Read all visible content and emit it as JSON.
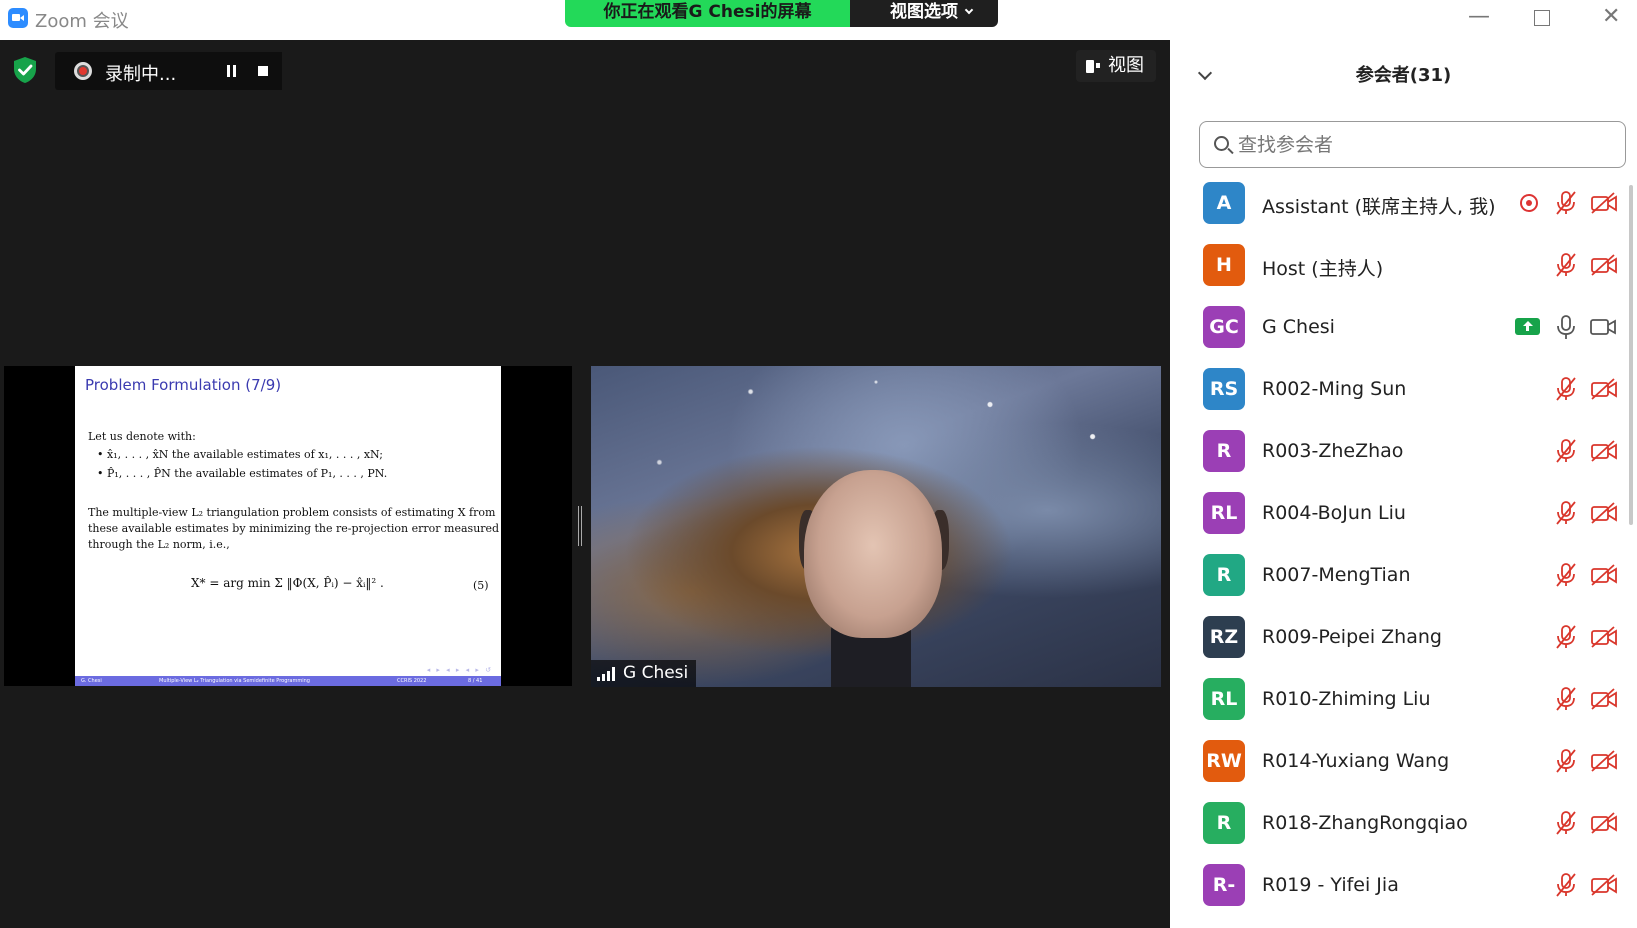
{
  "window": {
    "title": "Zoom 会议",
    "viewing_banner": "你正在观看G  Chesi的屏幕",
    "view_options": "视图选项"
  },
  "toolbar": {
    "recording_label": "录制中...",
    "view_label": "视图"
  },
  "slide": {
    "title": "Problem Formulation (7/9)",
    "intro": "Let us denote with:",
    "bullet_1": "• x̂₁, . . . , x̂N the available estimates of x₁, . . . , xN;",
    "bullet_2": "• P̂₁, . . . , P̂N the available estimates of P₁, . . . , PN.",
    "para_1": "The multiple-view L₂ triangulation problem consists of estimating X from",
    "para_2": "these available estimates by minimizing the re-projection error measured",
    "para_3": "through the L₂ norm, i.e.,",
    "equation": "X* = arg min Σ ‖Φ(X, P̂ᵢ) − x̂ᵢ‖²  .",
    "equation_number": "(5)",
    "footer_author": "G. Chesi",
    "footer_title": "Multiple-View L₂ Triangulation via Semidefinite Programming",
    "footer_venue": "CCRIS 2022",
    "footer_page": "8 / 41"
  },
  "video": {
    "name": "G Chesi"
  },
  "participants_panel": {
    "title": "参会者(31)",
    "search_placeholder": "查找参会者",
    "items": [
      {
        "initials": "A",
        "name": "Assistant (联席主持人, 我)",
        "color": "#2e86c8",
        "recording": true,
        "sharing": false,
        "mic": "off",
        "video": "off"
      },
      {
        "initials": "H",
        "name": "Host (主持人)",
        "color": "#e25b0e",
        "recording": false,
        "sharing": false,
        "mic": "off",
        "video": "off"
      },
      {
        "initials": "GC",
        "name": "G Chesi",
        "color": "#9b3fb5",
        "recording": false,
        "sharing": true,
        "mic": "on",
        "video": "on"
      },
      {
        "initials": "RS",
        "name": "R002-Ming Sun",
        "color": "#2e86c8",
        "recording": false,
        "sharing": false,
        "mic": "off",
        "video": "off"
      },
      {
        "initials": "R",
        "name": "R003-ZheZhao",
        "color": "#9b3fb5",
        "recording": false,
        "sharing": false,
        "mic": "off",
        "video": "off"
      },
      {
        "initials": "RL",
        "name": "R004-BoJun Liu",
        "color": "#9b3fb5",
        "recording": false,
        "sharing": false,
        "mic": "off",
        "video": "off"
      },
      {
        "initials": "R",
        "name": "R007-MengTian",
        "color": "#21a884",
        "recording": false,
        "sharing": false,
        "mic": "off",
        "video": "off"
      },
      {
        "initials": "RZ",
        "name": "R009-Peipei Zhang",
        "color": "#2d3e50",
        "recording": false,
        "sharing": false,
        "mic": "off",
        "video": "off"
      },
      {
        "initials": "RL",
        "name": "R010-Zhiming Liu",
        "color": "#27ae60",
        "recording": false,
        "sharing": false,
        "mic": "off",
        "video": "off"
      },
      {
        "initials": "RW",
        "name": "R014-Yuxiang Wang",
        "color": "#e25b0e",
        "recording": false,
        "sharing": false,
        "mic": "off",
        "video": "off"
      },
      {
        "initials": "R",
        "name": "R018-ZhangRongqiao",
        "color": "#27ae60",
        "recording": false,
        "sharing": false,
        "mic": "off",
        "video": "off"
      },
      {
        "initials": "R-",
        "name": "R019 - Yifei Jia",
        "color": "#9b3fb5",
        "recording": false,
        "sharing": false,
        "mic": "off",
        "video": "off"
      }
    ]
  },
  "colors": {
    "banner_green": "#23d959",
    "meeting_bg": "#1a1a1a",
    "muted_red": "#d9362b"
  }
}
